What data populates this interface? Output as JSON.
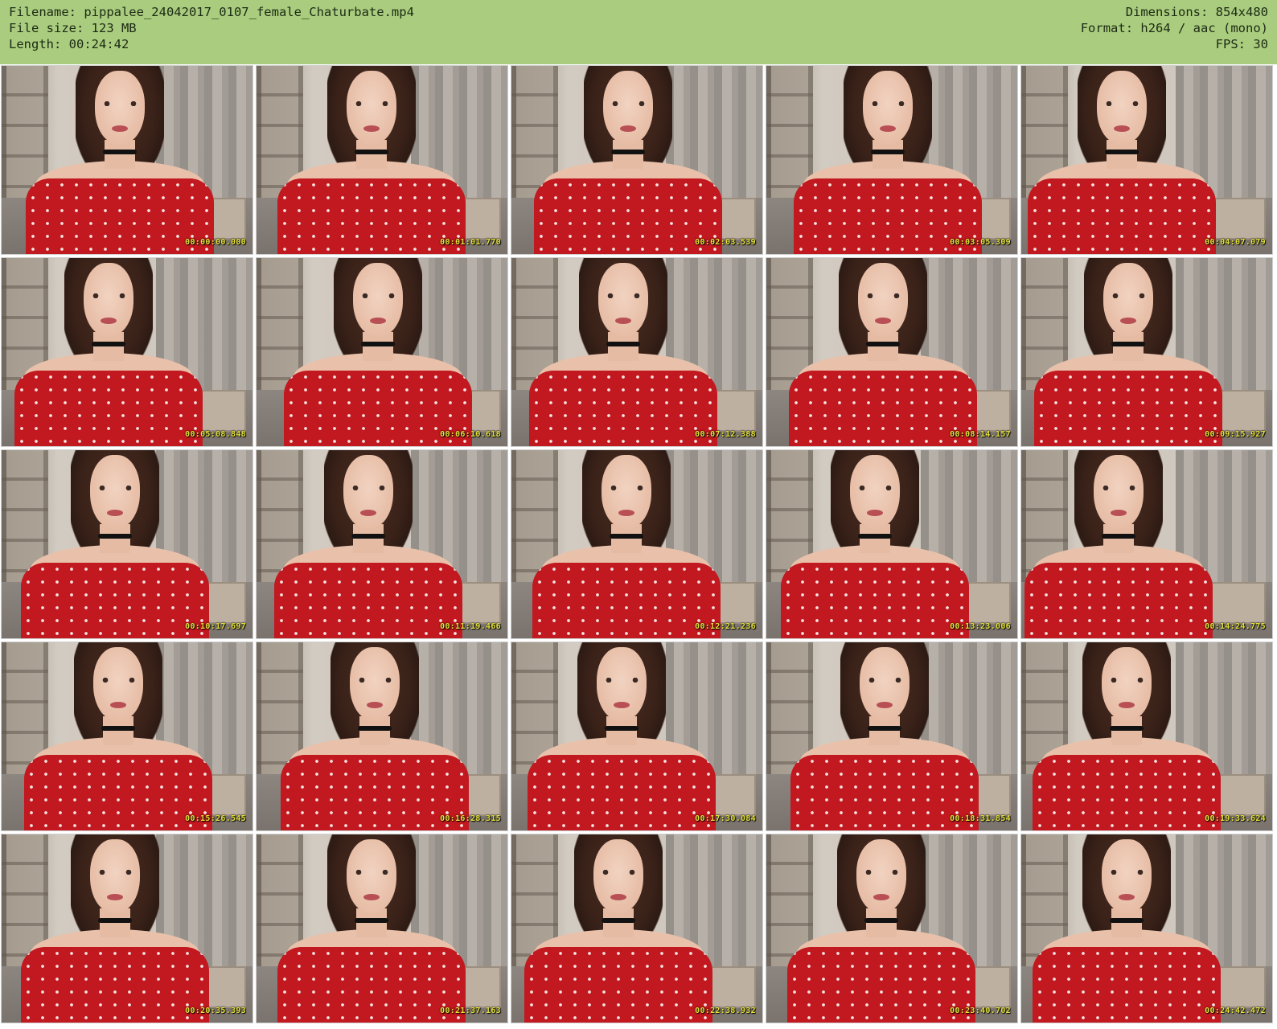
{
  "header": {
    "filename_line": "Filename: pippalee_24042017_0107_female_Chaturbate.mp4",
    "filesize_line": "File size: 123 MB",
    "length_line": "Length: 00:24:42",
    "dimensions_line": "Dimensions: 854x480",
    "format_line": "Format: h264 / aac (mono)",
    "fps_line": "FPS: 30",
    "background_color": "#a9cc7e"
  },
  "thumbnails": [
    {
      "timestamp": "00:00:00.000"
    },
    {
      "timestamp": "00:01:01.770"
    },
    {
      "timestamp": "00:02:03.539"
    },
    {
      "timestamp": "00:03:05.309"
    },
    {
      "timestamp": "00:04:07.079"
    },
    {
      "timestamp": "00:05:08.848"
    },
    {
      "timestamp": "00:06:10.618"
    },
    {
      "timestamp": "00:07:12.388"
    },
    {
      "timestamp": "00:08:14.157"
    },
    {
      "timestamp": "00:09:15.927"
    },
    {
      "timestamp": "00:10:17.697"
    },
    {
      "timestamp": "00:11:19.466"
    },
    {
      "timestamp": "00:12:21.236"
    },
    {
      "timestamp": "00:13:23.006"
    },
    {
      "timestamp": "00:14:24.775"
    },
    {
      "timestamp": "00:15:26.545"
    },
    {
      "timestamp": "00:16:28.315"
    },
    {
      "timestamp": "00:17:30.084"
    },
    {
      "timestamp": "00:18:31.854"
    },
    {
      "timestamp": "00:19:33.624"
    },
    {
      "timestamp": "00:20:35.393"
    },
    {
      "timestamp": "00:21:37.163"
    },
    {
      "timestamp": "00:22:38.932"
    },
    {
      "timestamp": "00:23:40.702"
    },
    {
      "timestamp": "00:24:42.472"
    }
  ]
}
